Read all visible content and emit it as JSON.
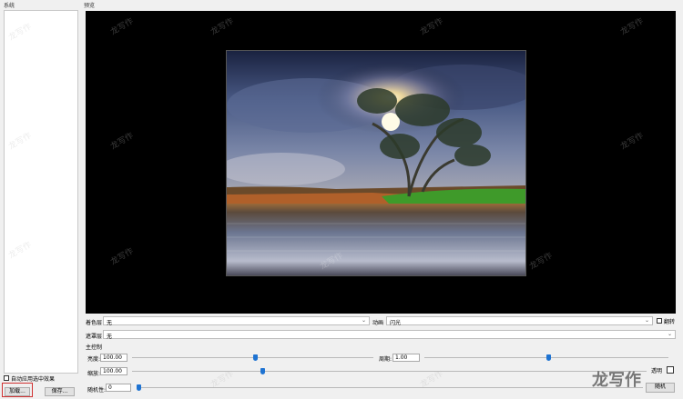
{
  "left_panel": {
    "group_label": "系统",
    "checkbox_label": "自动应用选中效果",
    "load_button": "加载...",
    "save_button": "保存..."
  },
  "preview": {
    "group_label": "预览"
  },
  "controls": {
    "color_layer_label": "着色层",
    "color_layer_value": "无",
    "effect_label": "动画",
    "effect_value": "闪光",
    "flip_label": "翻转",
    "mask_layer_label": "遮罩层",
    "mask_layer_value": "无",
    "main_control_label": "主控制",
    "brightness_label": "亮度:",
    "brightness_value": "100.00",
    "brightness_level": 0.5,
    "period_label": "周期:",
    "period_value": "1.00",
    "period_level": 0.5,
    "scale_label": "缩放:",
    "scale_value": "100.00",
    "scale_level": 0.3,
    "random_label": "随机性:",
    "random_value": "0",
    "random_level": 0.0,
    "transparent_label": "透明",
    "random_button": "随机"
  },
  "watermarks": [
    "龙写作"
  ],
  "brand": {
    "text": "龙写作"
  }
}
